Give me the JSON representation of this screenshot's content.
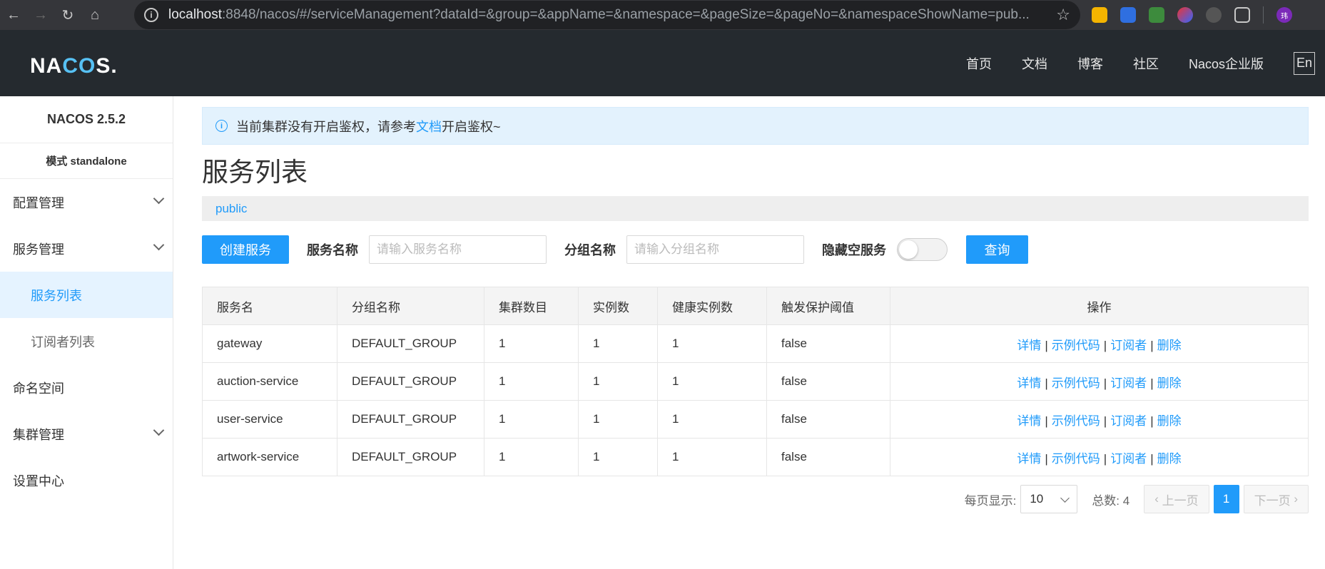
{
  "browser": {
    "url_host": "localhost",
    "url_rest": ":8848/nacos/#/serviceManagement?dataId=&group=&appName=&namespace=&pageSize=&pageNo=&namespaceShowName=pub...",
    "avatar_text": "玮"
  },
  "header": {
    "logo_pre": "NA",
    "logo_accent": "CO",
    "logo_post": "S.",
    "nav": [
      "首页",
      "文档",
      "博客",
      "社区",
      "Nacos企业版"
    ],
    "lang": "En"
  },
  "sidebar": {
    "version": "NACOS 2.5.2",
    "mode": "模式 standalone",
    "items": [
      {
        "label": "配置管理"
      },
      {
        "label": "服务管理"
      },
      {
        "label": "服务列表"
      },
      {
        "label": "订阅者列表"
      },
      {
        "label": "命名空间"
      },
      {
        "label": "集群管理"
      },
      {
        "label": "设置中心"
      }
    ]
  },
  "notice": {
    "text_before": "当前集群没有开启鉴权，请参考",
    "link": "文档",
    "text_after": "开启鉴权~"
  },
  "page_title": "服务列表",
  "namespace": "public",
  "toolbar": {
    "create_label": "创建服务",
    "service_name_label": "服务名称",
    "service_name_placeholder": "请输入服务名称",
    "group_name_label": "分组名称",
    "group_name_placeholder": "请输入分组名称",
    "hide_empty_label": "隐藏空服务",
    "query_label": "查询"
  },
  "table": {
    "headers": [
      "服务名",
      "分组名称",
      "集群数目",
      "实例数",
      "健康实例数",
      "触发保护阈值",
      "操作"
    ],
    "rows": [
      {
        "name": "gateway",
        "group": "DEFAULT_GROUP",
        "clusters": "1",
        "instances": "1",
        "healthy": "1",
        "threshold": "false"
      },
      {
        "name": "auction-service",
        "group": "DEFAULT_GROUP",
        "clusters": "1",
        "instances": "1",
        "healthy": "1",
        "threshold": "false"
      },
      {
        "name": "user-service",
        "group": "DEFAULT_GROUP",
        "clusters": "1",
        "instances": "1",
        "healthy": "1",
        "threshold": "false"
      },
      {
        "name": "artwork-service",
        "group": "DEFAULT_GROUP",
        "clusters": "1",
        "instances": "1",
        "healthy": "1",
        "threshold": "false"
      }
    ],
    "actions": {
      "detail": "详情",
      "sample": "示例代码",
      "subscriber": "订阅者",
      "delete": "删除",
      "sep": "|"
    }
  },
  "pager": {
    "page_size_label": "每页显示:",
    "page_size": "10",
    "total_label": "总数: 4",
    "prev": "上一页",
    "current": "1",
    "next": "下一页"
  }
}
